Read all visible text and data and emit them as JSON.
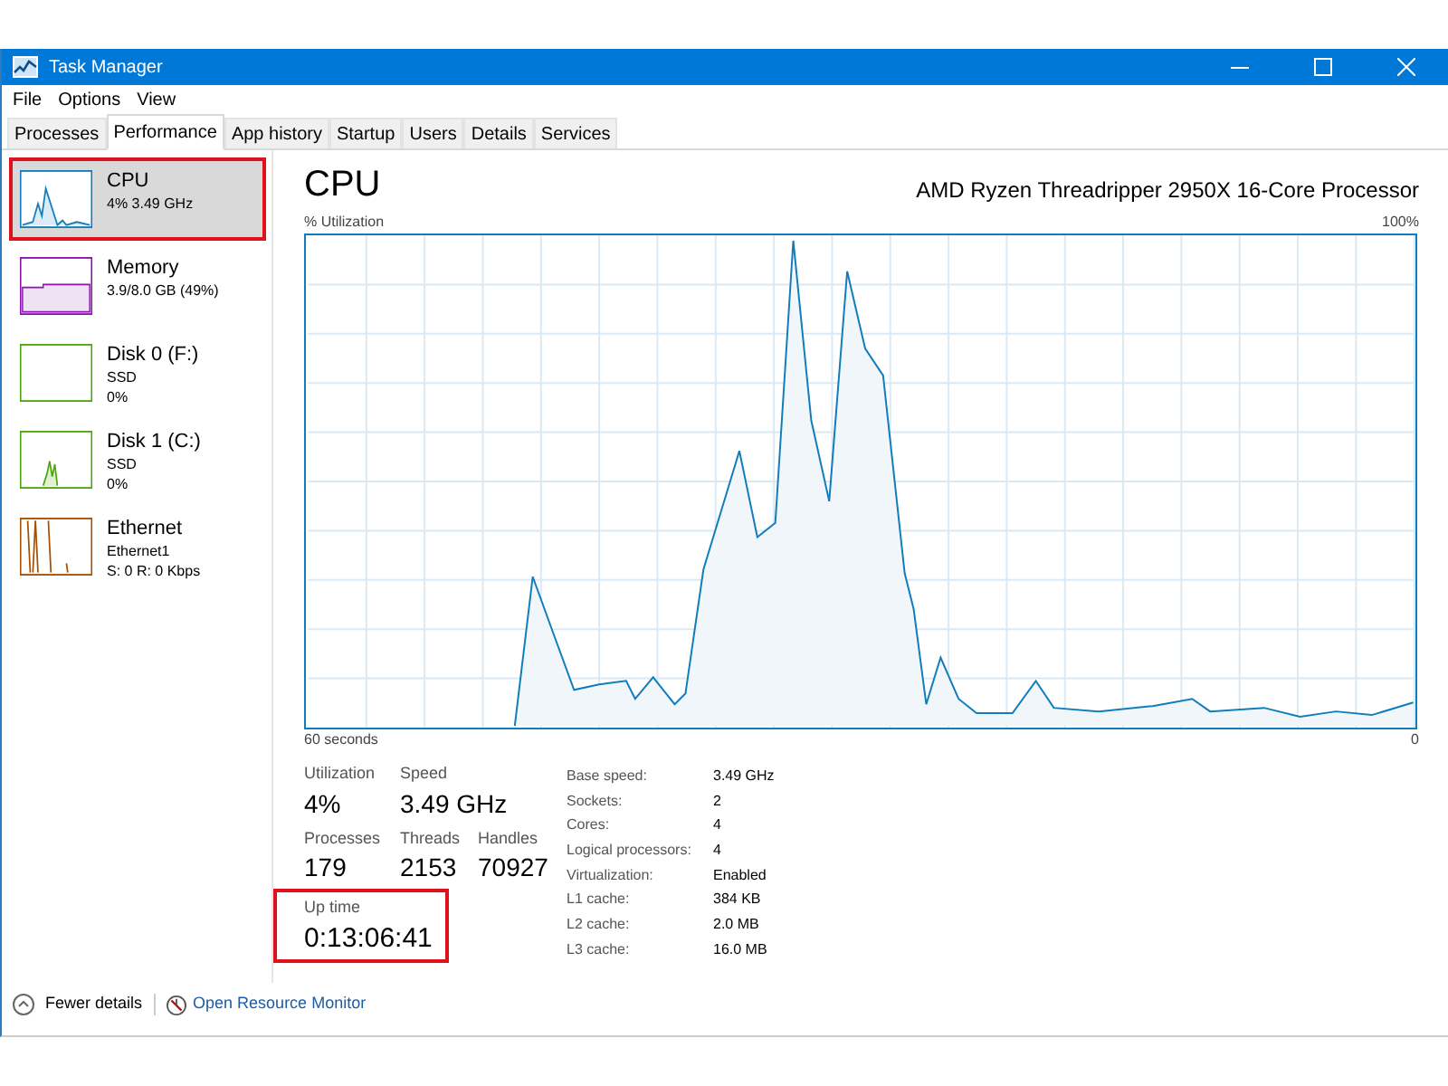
{
  "window": {
    "title": "Task Manager"
  },
  "menu": [
    "File",
    "Options",
    "View"
  ],
  "tabs": [
    {
      "label": "Processes",
      "selected": false
    },
    {
      "label": "Performance",
      "selected": true
    },
    {
      "label": "App history",
      "selected": false
    },
    {
      "label": "Startup",
      "selected": false
    },
    {
      "label": "Users",
      "selected": false
    },
    {
      "label": "Details",
      "selected": false
    },
    {
      "label": "Services",
      "selected": false
    }
  ],
  "sidebar": {
    "items": [
      {
        "kind": "cpu",
        "name": "CPU",
        "lines": [
          "4% 3.49 GHz"
        ],
        "color": "#117dbb",
        "selected": true,
        "highlighted": true
      },
      {
        "kind": "memory",
        "name": "Memory",
        "lines": [
          "3.9/8.0 GB (49%)"
        ],
        "color": "#8b12ae",
        "selected": false,
        "highlighted": false
      },
      {
        "kind": "disk",
        "name": "Disk 0 (F:)",
        "lines": [
          "SSD",
          "0%"
        ],
        "color": "#4da60c",
        "selected": false,
        "highlighted": false
      },
      {
        "kind": "disk_active",
        "name": "Disk 1 (C:)",
        "lines": [
          "SSD",
          "0%"
        ],
        "color": "#4da60c",
        "selected": false,
        "highlighted": false
      },
      {
        "kind": "ethernet",
        "name": "Ethernet",
        "lines": [
          "Ethernet1",
          "S: 0 R: 0 Kbps"
        ],
        "color": "#a74f01",
        "selected": false,
        "highlighted": false
      }
    ]
  },
  "main": {
    "title": "CPU",
    "processor": "AMD Ryzen Threadripper 2950X 16-Core Processor",
    "graph_label": "% Utilization",
    "graph_max": "100%",
    "graph_time": "60 seconds",
    "graph_min": "0",
    "stats": [
      {
        "label": "Utilization",
        "value": "4%"
      },
      {
        "label": "Speed",
        "value": "3.49 GHz"
      },
      {
        "label": "Processes",
        "value": "179"
      },
      {
        "label": "Threads",
        "value": "2153"
      },
      {
        "label": "Handles",
        "value": "70927"
      }
    ],
    "uptime": {
      "label": "Up time",
      "value": "0:13:06:41",
      "highlighted": true
    },
    "specs": [
      {
        "label": "Base speed:",
        "value": "3.49 GHz"
      },
      {
        "label": "Sockets:",
        "value": "2"
      },
      {
        "label": "Cores:",
        "value": "4"
      },
      {
        "label": "Logical processors:",
        "value": "4"
      },
      {
        "label": "Virtualization:",
        "value": "Enabled"
      },
      {
        "label": "L1 cache:",
        "value": "384 KB"
      },
      {
        "label": "L2 cache:",
        "value": "2.0 MB"
      },
      {
        "label": "L3 cache:",
        "value": "16.0 MB"
      }
    ]
  },
  "footer": {
    "fewer_details": "Fewer details",
    "resource_monitor": "Open Resource Monitor"
  }
}
